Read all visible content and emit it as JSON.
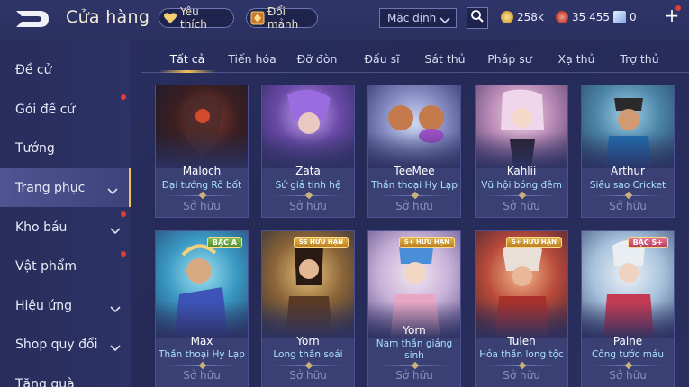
{
  "header": {
    "title": "Cửa hàng",
    "favorites_label": "Yêu thích",
    "exchange_label": "Đổi mảnh",
    "sort_value": "Mặc định",
    "currency_gold": "258k",
    "currency_gems": "35 455",
    "currency_vouchers": "0"
  },
  "sidebar": {
    "items": [
      {
        "label": "Đề cử"
      },
      {
        "label": "Gói đề cử"
      },
      {
        "label": "Tướng"
      },
      {
        "label": "Trang phục"
      },
      {
        "label": "Kho báu"
      },
      {
        "label": "Vật phẩm"
      },
      {
        "label": "Hiệu ứng"
      },
      {
        "label": "Shop quy đổi"
      },
      {
        "label": "Tặng quà"
      }
    ]
  },
  "tabs": [
    {
      "label": "Tất cả"
    },
    {
      "label": "Tiến hóa"
    },
    {
      "label": "Đỡ đòn"
    },
    {
      "label": "Đấu sĩ"
    },
    {
      "label": "Sát thủ"
    },
    {
      "label": "Pháp sư"
    },
    {
      "label": "Xạ thủ"
    },
    {
      "label": "Trợ thủ"
    }
  ],
  "skins": [
    {
      "hero": "Maloch",
      "skin": "Đại tướng Rô bốt",
      "status": "Sở hữu",
      "badge": ""
    },
    {
      "hero": "Zata",
      "skin": "Sứ giả tinh hệ",
      "status": "Sở hữu",
      "badge": ""
    },
    {
      "hero": "TeeMee",
      "skin": "Thần thoại Hy Lạp",
      "status": "Sở hữu",
      "badge": ""
    },
    {
      "hero": "Kahlii",
      "skin": "Vũ hội bóng đêm",
      "status": "Sở hữu",
      "badge": ""
    },
    {
      "hero": "Arthur",
      "skin": "Siêu sao Cricket",
      "status": "Sở hữu",
      "badge": ""
    },
    {
      "hero": "Max",
      "skin": "Thần thoại Hy Lạp",
      "status": "Sở hữu",
      "badge": "BẬC A"
    },
    {
      "hero": "Yorn",
      "skin": "Long thần soái",
      "status": "Sở hữu",
      "badge": "SS HỮU HẠN"
    },
    {
      "hero": "Yorn",
      "skin": "Nam thần giáng sinh",
      "status": "Sở hữu",
      "badge": "S+ HỮU HẠN"
    },
    {
      "hero": "Tulen",
      "skin": "Hỏa thần long tộc",
      "status": "Sở hữu",
      "badge": "S+ HỮU HẠN"
    },
    {
      "hero": "Paine",
      "skin": "Công tước máu",
      "status": "Sở hữu",
      "badge": "BẬC S+"
    }
  ],
  "colors": {
    "accent_gold": "#f0c35a",
    "skin_text": "#a9e0ff",
    "notification_dot": "#e23b3b"
  }
}
